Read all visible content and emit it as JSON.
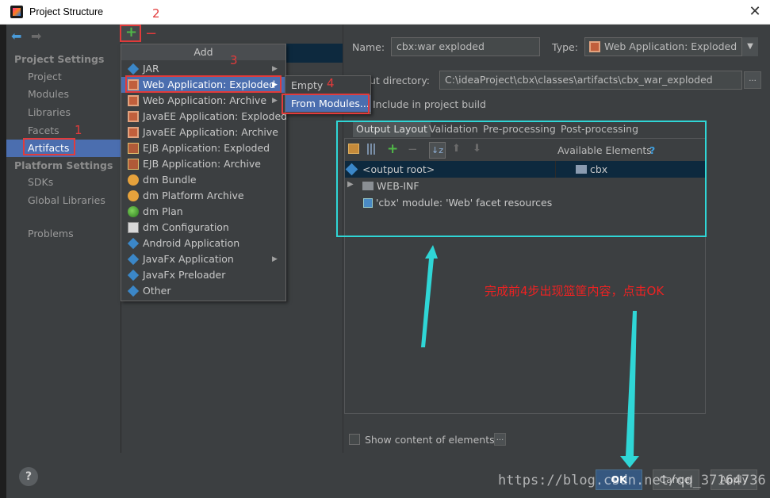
{
  "window": {
    "title": "Project Structure",
    "close_glyph": "✕"
  },
  "nav": {
    "back": "⬅",
    "forward": "➡"
  },
  "sidebar": {
    "project_settings_header": "Project Settings",
    "items": [
      "Project",
      "Modules",
      "Libraries",
      "Facets",
      "Artifacts"
    ],
    "platform_settings_header": "Platform Settings",
    "platform_items": [
      "SDKs",
      "Global Libraries"
    ],
    "problems": "Problems",
    "selected": "Artifacts"
  },
  "toolbar": {
    "add_glyph": "+",
    "remove_glyph": "−"
  },
  "annotations": {
    "step1": "1",
    "step2": "2",
    "step3": "3",
    "step4": "4"
  },
  "add_menu": {
    "header": "Add",
    "items": [
      {
        "label": "JAR",
        "icon": "jar-icon",
        "submenu": true
      },
      {
        "label": "Web Application: Exploded",
        "icon": "web-app-icon",
        "submenu": true,
        "highlighted": true
      },
      {
        "label": "Web Application: Archive",
        "icon": "web-app-icon",
        "submenu": true
      },
      {
        "label": "JavaEE Application: Exploded",
        "icon": "javaee-icon",
        "submenu": false
      },
      {
        "label": "JavaEE Application: Archive",
        "icon": "javaee-icon",
        "submenu": false
      },
      {
        "label": "EJB Application: Exploded",
        "icon": "ejb-icon",
        "submenu": false
      },
      {
        "label": "EJB Application: Archive",
        "icon": "ejb-icon",
        "submenu": false
      },
      {
        "label": "dm Bundle",
        "icon": "dm-bundle-icon",
        "submenu": false
      },
      {
        "label": "dm Platform Archive",
        "icon": "dm-bundle-icon",
        "submenu": false
      },
      {
        "label": "dm Plan",
        "icon": "globe-icon",
        "submenu": false
      },
      {
        "label": "dm Configuration",
        "icon": "file-icon",
        "submenu": false
      },
      {
        "label": "Android Application",
        "icon": "android-icon",
        "submenu": false
      },
      {
        "label": "JavaFx Application",
        "icon": "javafx-icon",
        "submenu": true
      },
      {
        "label": "JavaFx Preloader",
        "icon": "javafx-icon",
        "submenu": false
      },
      {
        "label": "Other",
        "icon": "other-icon",
        "submenu": false
      }
    ]
  },
  "sub_menu": {
    "items": [
      "Empty",
      "From Modules..."
    ],
    "highlighted": "From Modules..."
  },
  "artifact": {
    "name_label": "Name:",
    "name_value": "cbx:war exploded",
    "type_label": "Type:",
    "type_value": "Web Application: Exploded",
    "output_dir_label": "Output directory:",
    "output_dir_label_visible": "ut directory:",
    "output_dir_value": "C:\\ideaProject\\cbx\\classes\\artifacts\\cbx_war_exploded",
    "include_in_build": "Include in project build",
    "browse": "..."
  },
  "tabs": [
    "Output Layout",
    "Validation",
    "Pre-processing",
    "Post-processing"
  ],
  "active_tab": "Output Layout",
  "layout": {
    "available_elements_label": "Available Elements",
    "help_glyph": "?",
    "tree": [
      "<output root>",
      "WEB-INF",
      "'cbx' module: 'Web' facet resources"
    ],
    "available": [
      "cbx"
    ],
    "show_content": "Show content of elements",
    "more": "..."
  },
  "instruction": "完成前4步出现篮筐内容，点击OK",
  "buttons": {
    "help": "?",
    "ok": "OK",
    "cancel": "Cancel",
    "apply": "Apply"
  },
  "watermark": "https://blog.csdn.net/qq_37164736",
  "colors": {
    "background": "#3c3f41",
    "selection": "#4b6eaf",
    "annotation_red": "#e23b3b",
    "annotation_cyan": "#2fd6d6"
  }
}
